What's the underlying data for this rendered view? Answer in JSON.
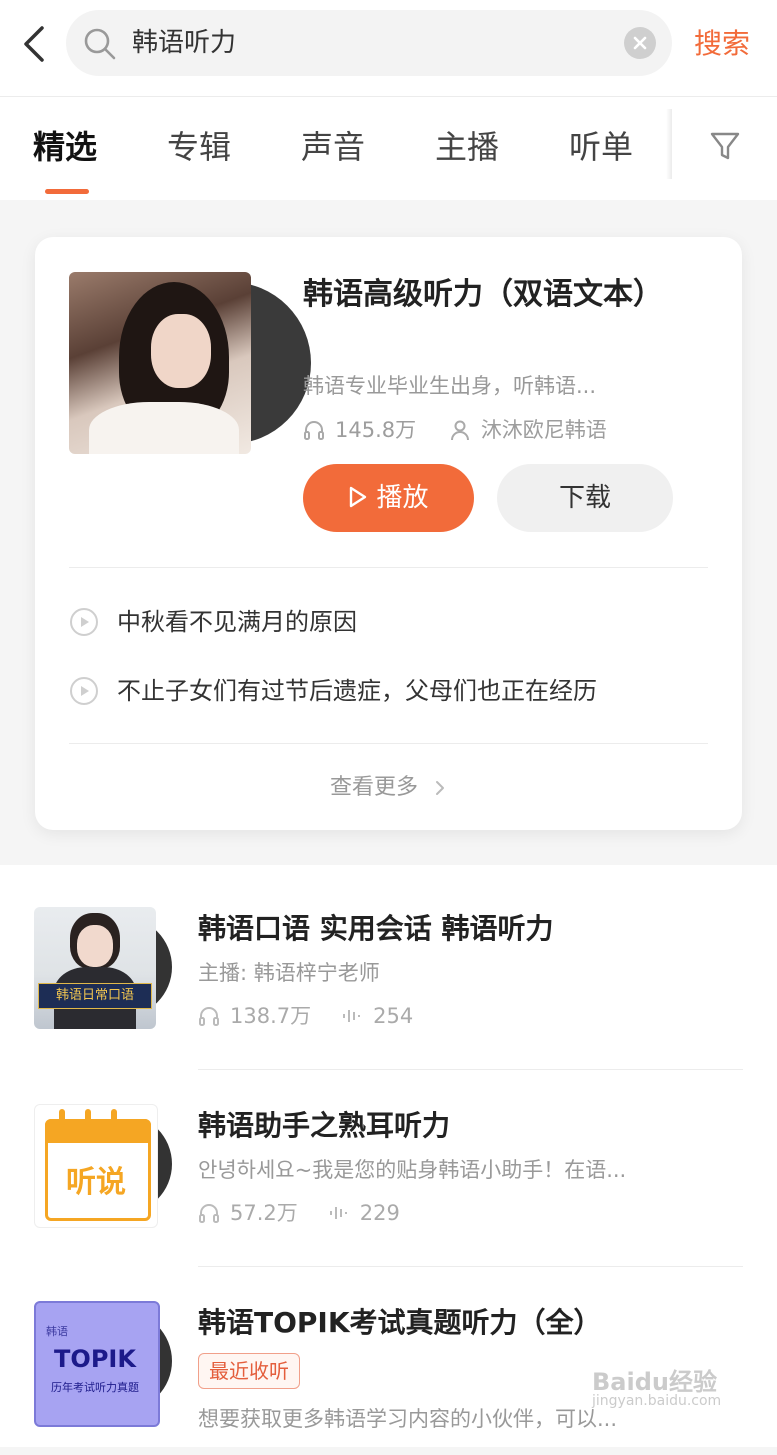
{
  "search": {
    "query": "韩语听力",
    "action_label": "搜索"
  },
  "tabs": [
    {
      "label": "精选"
    },
    {
      "label": "专辑"
    },
    {
      "label": "声音"
    },
    {
      "label": "主播"
    },
    {
      "label": "听单"
    }
  ],
  "featured": {
    "title": "韩语高级听力（双语文本）",
    "description": "韩语专业毕业生出身，听韩语...",
    "plays": "145.8万",
    "author": "沐沐欧尼韩语",
    "play_label": "播放",
    "download_label": "下载",
    "episodes": [
      {
        "title": "中秋看不见满月的原因"
      },
      {
        "title": "不止子女们有过节后遗症，父母们也正在经历"
      }
    ],
    "more_label": "查看更多"
  },
  "results": [
    {
      "title": "韩语口语 实用会话 韩语听力",
      "subtitle": "主播: 韩语梓宁老师",
      "plays": "138.7万",
      "tracks": "254",
      "cover_caption": "韩语日常口语"
    },
    {
      "title": "韩语助手之熟耳听力",
      "subtitle": "안녕하세요~我是您的贴身韩语小助手！在语...",
      "plays": "57.2万",
      "tracks": "229",
      "cover_caption": "听说"
    },
    {
      "title": "韩语TOPIK考试真题听力（全）",
      "tag": "最近收听",
      "subtitle": "想要获取更多韩语学习内容的小伙伴，可以...",
      "cover_small": "韩语",
      "cover_big": "TOPIK",
      "cover_caption": "历年考试听力真题"
    }
  ],
  "watermark": {
    "text": "Baidu经验",
    "url": "jingyan.baidu.com"
  },
  "colors": {
    "accent": "#f26b3a"
  }
}
